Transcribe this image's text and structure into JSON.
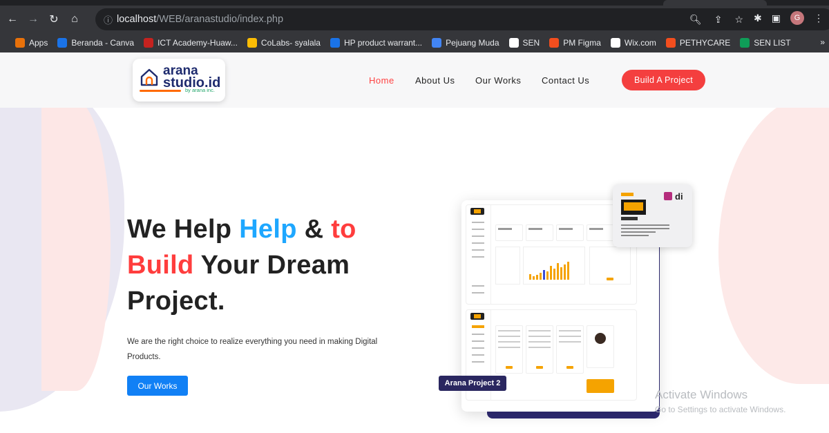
{
  "browser": {
    "url_host": "localhost",
    "url_path": "/WEB/aranastudio/index.php",
    "profile_initial": "G",
    "bookmarks": [
      {
        "label": "Apps",
        "color": "#e8710a"
      },
      {
        "label": "Beranda - Canva",
        "color": "#1a73e8"
      },
      {
        "label": "ICT Academy-Huaw...",
        "color": "#c5221f"
      },
      {
        "label": "CoLabs- syalala",
        "color": "#fbbc04"
      },
      {
        "label": "HP product warrant...",
        "color": "#1a73e8"
      },
      {
        "label": "Pejuang Muda",
        "color": "#4285f4"
      },
      {
        "label": "SEN",
        "color": "#fff"
      },
      {
        "label": "PM Figma",
        "color": "#f24e1e"
      },
      {
        "label": "Wix.com",
        "color": "#fff"
      },
      {
        "label": "PETHYCARE",
        "color": "#f24e1e"
      },
      {
        "label": "SEN LIST",
        "color": "#0f9d58"
      }
    ],
    "more_label": "»"
  },
  "logo": {
    "line1": "arana",
    "line2": "studio.id",
    "sub": "by arana inc."
  },
  "nav": {
    "home": "Home",
    "about": "About Us",
    "works": "Our Works",
    "contact": "Contact Us",
    "cta": "Build A Project"
  },
  "hero": {
    "l1a": "We Help ",
    "l1b": "Help",
    "l1c": " & ",
    "l1d": "to",
    "l2a": "Build",
    "l2b": " Your Dream",
    "l3": "Project.",
    "desc": "We are the right choice to realize everything you need in making Digital Products.",
    "button": "Our Works"
  },
  "showcase": {
    "label": "Arana Project 2"
  },
  "watermark": {
    "line1": "Activate Windows",
    "line2": "Go to Settings to activate Windows."
  },
  "colors": {
    "accent_red": "#f43f3f",
    "accent_blue": "#1ea7ff",
    "button_blue": "#1180f5",
    "brand_navy": "#1e2b6e"
  }
}
